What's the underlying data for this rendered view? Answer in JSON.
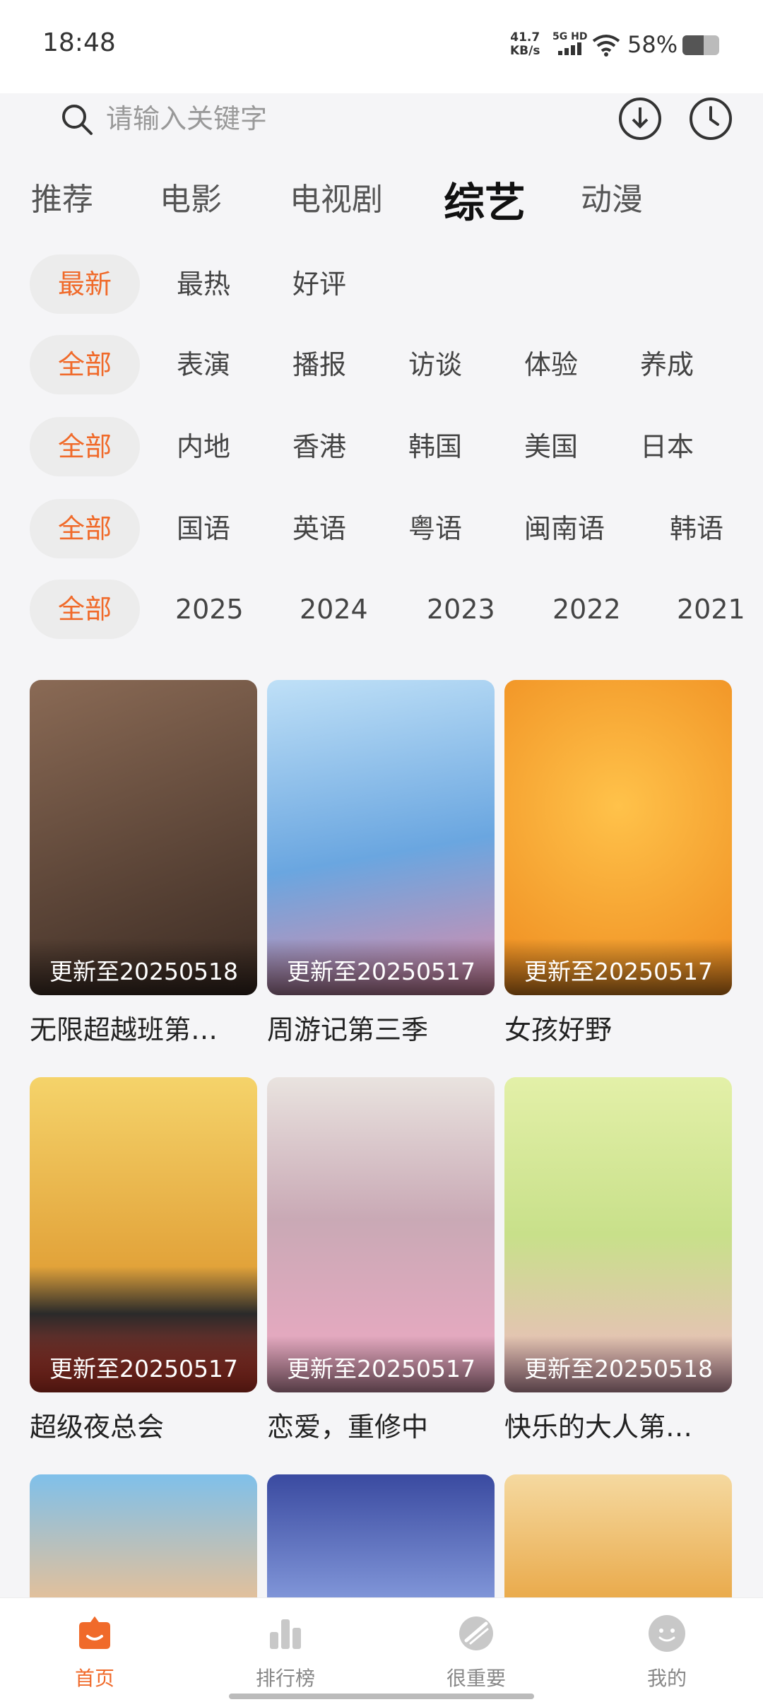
{
  "status_bar": {
    "time": "18:48",
    "net_speed_value": "41.7",
    "net_speed_unit": "KB/s",
    "network": "5G HD",
    "battery_percent": "58%",
    "battery_level": 0.58
  },
  "search": {
    "placeholder": "请输入关键字"
  },
  "category_tabs": [
    {
      "label": "推荐"
    },
    {
      "label": "电影"
    },
    {
      "label": "电视剧"
    },
    {
      "label": "综艺",
      "active": true
    },
    {
      "label": "动漫"
    }
  ],
  "sort_filters": [
    "最新",
    "最热",
    "好评"
  ],
  "type_filters": [
    "全部",
    "表演",
    "播报",
    "访谈",
    "体验",
    "养成"
  ],
  "region_filters": [
    "全部",
    "内地",
    "香港",
    "韩国",
    "美国",
    "日本"
  ],
  "language_filters": [
    "全部",
    "国语",
    "英语",
    "粤语",
    "闽南语",
    "韩语"
  ],
  "year_filters": [
    "全部",
    "2025",
    "2024",
    "2023",
    "2022",
    "2021"
  ],
  "cards": [
    {
      "title": "无限超越班第…",
      "update": "更新至20250518",
      "color": "#6b4b3a"
    },
    {
      "title": "周游记第三季",
      "update": "更新至20250517",
      "color": "#7fb7e6"
    },
    {
      "title": "女孩好野",
      "update": "更新至20250517",
      "color": "#f2a233"
    },
    {
      "title": "超级夜总会",
      "update": "更新至20250517",
      "color": "#e8c24a"
    },
    {
      "title": "恋爱，重修中",
      "update": "更新至20250517",
      "color": "#d9a7c0"
    },
    {
      "title": "快乐的大人第…",
      "update": "更新至20250518",
      "color": "#cfe39a"
    },
    {
      "title": "",
      "update": "",
      "color": "#8fbde0"
    },
    {
      "title": "",
      "update": "",
      "color": "#4a5aa8"
    },
    {
      "title": "",
      "update": "",
      "color": "#f0c06a"
    }
  ],
  "bottom_nav": [
    {
      "label": "首页",
      "icon": "home-icon",
      "active": true
    },
    {
      "label": "排行榜",
      "icon": "ranking-icon"
    },
    {
      "label": "很重要",
      "icon": "important-icon"
    },
    {
      "label": "我的",
      "icon": "profile-icon"
    }
  ],
  "colors": {
    "accent": "#f06a2a"
  }
}
